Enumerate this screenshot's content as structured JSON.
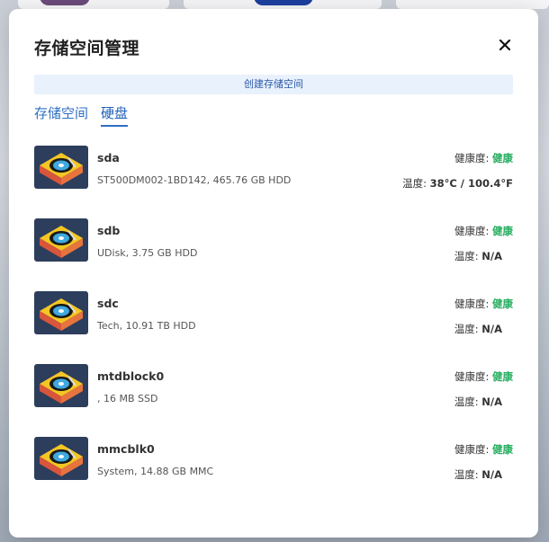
{
  "modal": {
    "title": "存储空间管理",
    "create_label": "创建存储空间",
    "tabs": [
      {
        "label": "存储空间",
        "active": false
      },
      {
        "label": "硬盘",
        "active": true
      }
    ]
  },
  "labels": {
    "health": "健康度: ",
    "temperature": "温度: "
  },
  "disks": [
    {
      "name": "sda",
      "desc": "ST500DM002-1BD142, 465.76 GB HDD",
      "health": "健康",
      "temp": "38°C / 100.4°F"
    },
    {
      "name": "sdb",
      "desc": "UDisk, 3.75 GB HDD",
      "health": "健康",
      "temp": "N/A"
    },
    {
      "name": "sdc",
      "desc": "Tech, 10.91 TB HDD",
      "health": "健康",
      "temp": "N/A"
    },
    {
      "name": "mtdblock0",
      "desc": ", 16 MB SSD",
      "health": "健康",
      "temp": "N/A"
    },
    {
      "name": "mmcblk0",
      "desc": "System, 14.88 GB MMC",
      "health": "健康",
      "temp": "N/A"
    }
  ],
  "colors": {
    "accent": "#2f6fc4",
    "healthy": "#27ae60",
    "create_bar_bg": "#e9f1fc"
  },
  "icons": {
    "close": "close-icon",
    "disk": "hard-disk-icon"
  }
}
